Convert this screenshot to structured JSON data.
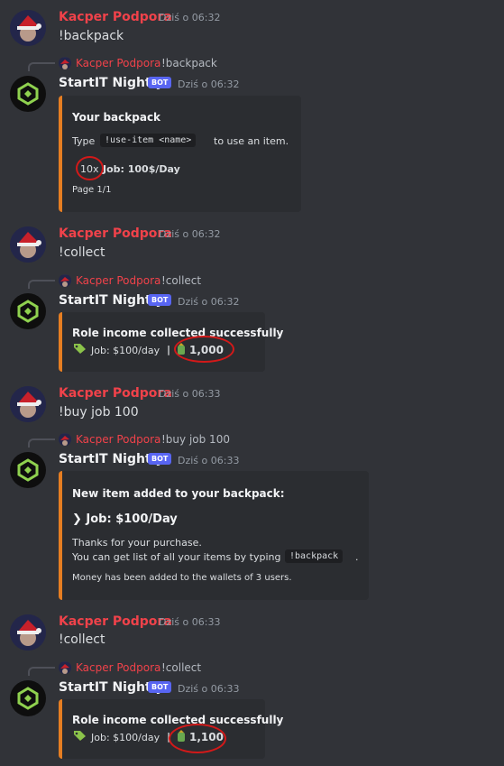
{
  "user": {
    "name": "Kacper Podpora"
  },
  "bot": {
    "name": "StartIT Nightly",
    "badge": "BOT"
  },
  "messages": [
    {
      "time": "Dziś o 06:32",
      "text": "!backpack"
    },
    {
      "time": "Dziś o 06:32",
      "text": "!collect"
    },
    {
      "time": "Dziś o 06:33",
      "text": "!buy job 100"
    },
    {
      "time": "Dziś o 06:33",
      "text": "!collect"
    }
  ],
  "replies": [
    {
      "time": "Dziś o 06:32",
      "ref": "!backpack"
    },
    {
      "time": "Dziś o 06:32",
      "ref": "!collect"
    },
    {
      "time": "Dziś o 06:33",
      "ref": "!buy job 100"
    },
    {
      "time": "Dziś o 06:33",
      "ref": "!collect"
    }
  ],
  "embed1": {
    "title": "Your backpack",
    "line_prefix": "Type",
    "code": "!use-item <name>",
    "line_suffix": "to use an item.",
    "item_count": "10x",
    "item_name": "Job: 100$/Day",
    "page": "Page 1/1"
  },
  "embed2": {
    "title": "Role income collected successfully",
    "job": "Job: $100/day",
    "sep": "|",
    "amount": "1,000"
  },
  "embed3": {
    "title": "New item added to your backpack:",
    "item": "❯ Job: $100/Day",
    "thanks": "Thanks for your purchase.",
    "list_prefix": "You can get list of all your items by typing",
    "code": "!backpack",
    "list_suffix": ".",
    "money": "Money has been added to the wallets of 3 users."
  },
  "embed4": {
    "title": "Role income collected successfully",
    "job": "Job: $100/day",
    "sep": "|",
    "amount": "1,100"
  },
  "colors": {
    "accent": "#e67e22",
    "username": "#f0424a",
    "badge": "#5865f2",
    "highlight": "#d31919"
  },
  "icons": [
    "tag-icon",
    "money-bag-icon",
    "bot-logo-icon",
    "santa-hat-avatar"
  ]
}
